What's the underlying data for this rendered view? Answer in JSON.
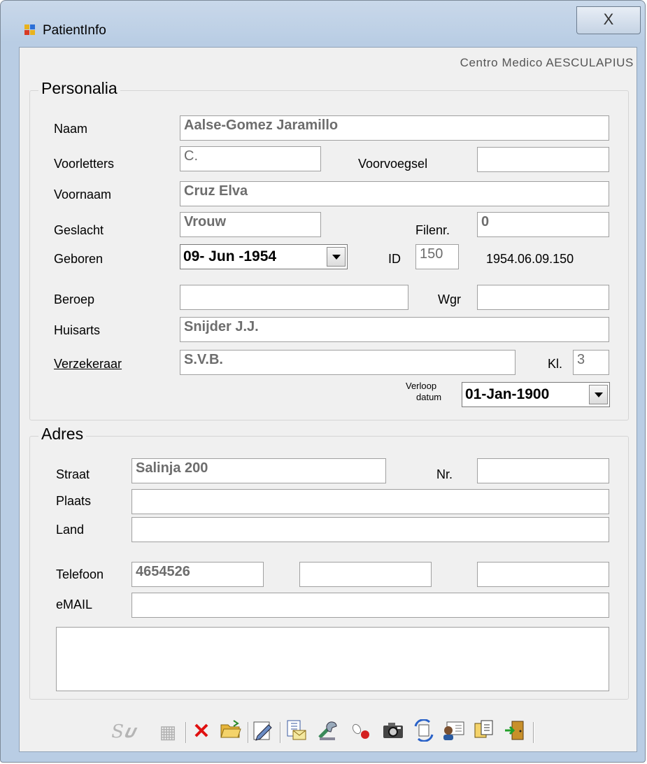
{
  "window": {
    "title": "PatientInfo",
    "close_glyph": "X"
  },
  "brand": "Centro Medico AESCULAPIUS",
  "personalia": {
    "title": "Personalia",
    "naam": {
      "label": "Naam",
      "value": "Aalse-Gomez Jaramillo"
    },
    "voorletters": {
      "label": "Voorletters",
      "value": "C."
    },
    "voorvoegsel": {
      "label": "Voorvoegsel",
      "value": ""
    },
    "voornaam": {
      "label": "Voornaam",
      "value": "Cruz Elva"
    },
    "geslacht": {
      "label": "Geslacht",
      "value": "Vrouw"
    },
    "filenr": {
      "label": "Filenr.",
      "value": "0"
    },
    "geboren": {
      "label": "Geboren",
      "value": "09- Jun -1954"
    },
    "id": {
      "label": "ID",
      "value": "150",
      "code": "1954.06.09.150"
    },
    "beroep": {
      "label": "Beroep",
      "value": ""
    },
    "wgr": {
      "label": "Wgr",
      "value": ""
    },
    "huisarts": {
      "label": "Huisarts",
      "value": "Snijder J.J."
    },
    "verzekeraar": {
      "label": "Verzekeraar",
      "value": "S.V.B."
    },
    "klasse": {
      "label": "Kl.",
      "value": "3"
    },
    "verloop": {
      "label_line1": "Verloop",
      "label_line2": "datum",
      "value": "01-Jan-1900"
    }
  },
  "adres": {
    "title": "Adres",
    "straat": {
      "label": "Straat",
      "value": "Salinja 200"
    },
    "nr": {
      "label": "Nr.",
      "value": ""
    },
    "plaats": {
      "label": "Plaats",
      "value": ""
    },
    "land": {
      "label": "Land",
      "value": ""
    },
    "telefoon": {
      "label": "Telefoon",
      "values": [
        "4654526",
        "",
        ""
      ]
    },
    "email": {
      "label": "eMAIL",
      "value": ""
    },
    "notes": ""
  },
  "toolbar": {
    "icons": [
      "search-icon",
      "calculator-icon",
      "delete-icon",
      "open-folder-icon",
      "edit-icon",
      "mail-document-icon",
      "tools-icon",
      "pills-icon",
      "camera-icon",
      "sync-icon",
      "contact-card-icon",
      "copy-icon",
      "exit-icon"
    ]
  },
  "colors": {
    "title_bar": "#b9cde4",
    "client": "#f0f0f0",
    "field_text": "#6d6d6d",
    "delete_red": "#e01010"
  }
}
